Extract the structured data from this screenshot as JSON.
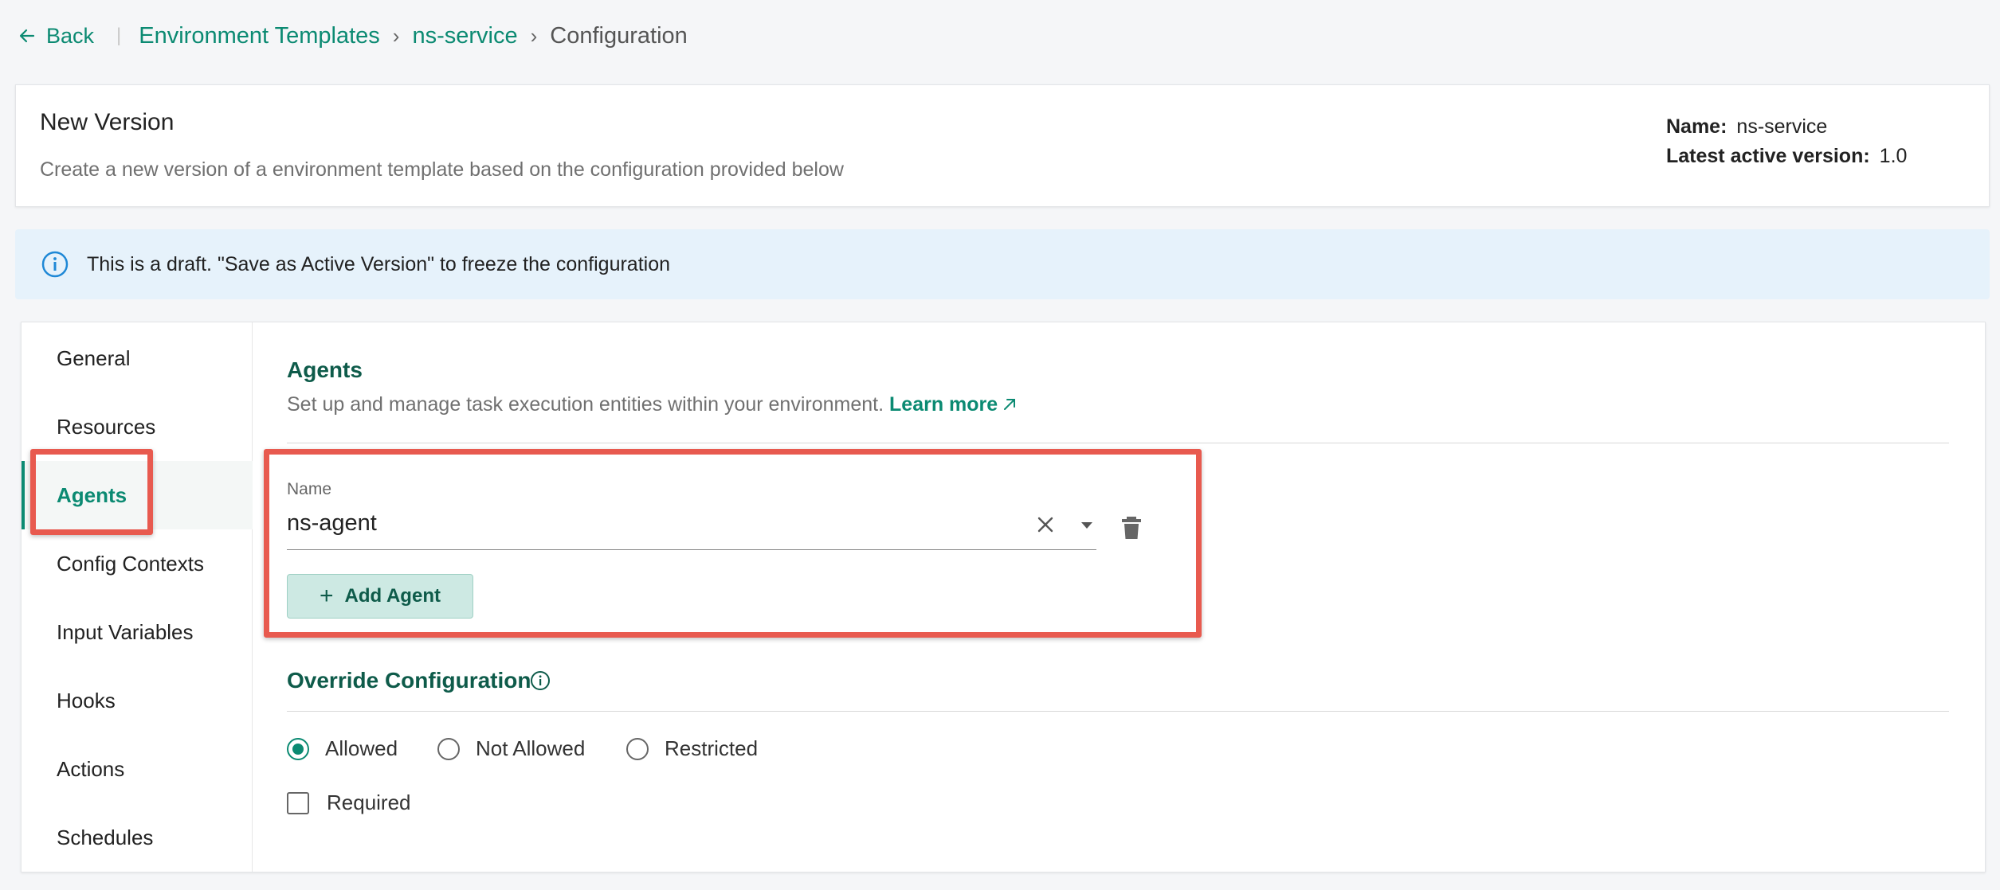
{
  "breadcrumb": {
    "back_label": "Back",
    "items": [
      "Environment Templates",
      "ns-service"
    ],
    "current": "Configuration",
    "separator": "›"
  },
  "header": {
    "title": "New Version",
    "description": "Create a new version of a environment template based on the configuration provided below",
    "name_label": "Name:",
    "name_value": "ns-service",
    "version_label": "Latest active version:",
    "version_value": "1.0"
  },
  "banner": {
    "text": "This is a draft. \"Save as Active Version\" to freeze the configuration",
    "icon": "info-icon"
  },
  "sidebar": {
    "items": [
      {
        "label": "General"
      },
      {
        "label": "Resources"
      },
      {
        "label": "Agents",
        "active": true
      },
      {
        "label": "Config Contexts"
      },
      {
        "label": "Input Variables"
      },
      {
        "label": "Hooks"
      },
      {
        "label": "Actions"
      },
      {
        "label": "Schedules"
      }
    ]
  },
  "agents": {
    "title": "Agents",
    "description": "Set up and manage task execution entities within your environment.",
    "learn_more": "Learn more",
    "field_label": "Name",
    "field_value": "ns-agent",
    "add_button": "Add Agent"
  },
  "override": {
    "title": "Override Configuration",
    "options": [
      {
        "label": "Allowed",
        "checked": true
      },
      {
        "label": "Not Allowed",
        "checked": false
      },
      {
        "label": "Restricted",
        "checked": false
      }
    ],
    "required_label": "Required",
    "required_checked": false
  },
  "colors": {
    "accent": "#0b8a72",
    "highlight": "#e85a4f",
    "banner_bg": "#e6f2fb"
  }
}
